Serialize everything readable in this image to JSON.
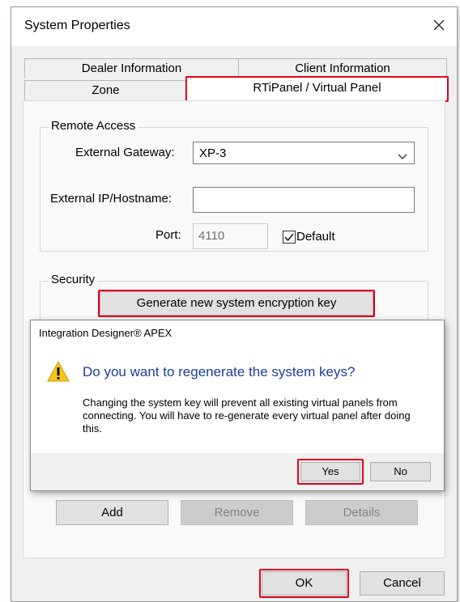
{
  "window": {
    "title": "System Properties"
  },
  "tabs": {
    "row1": [
      "Dealer Information",
      "Client Information"
    ],
    "row2": [
      "Zone",
      "RTiPanel / Virtual Panel"
    ]
  },
  "remote_access": {
    "group_label": "Remote Access",
    "gateway_label": "External Gateway:",
    "gateway_value": "XP-3",
    "ip_label": "External IP/Hostname:",
    "ip_value": "",
    "port_label": "Port:",
    "port_value": "4110",
    "default_label": "Default",
    "default_checked": true
  },
  "security": {
    "group_label": "Security",
    "generate_button": "Generate new system encryption key"
  },
  "panel_buttons": {
    "add": "Add",
    "remove": "Remove",
    "details": "Details"
  },
  "footer_buttons": {
    "ok": "OK",
    "cancel": "Cancel"
  },
  "dialog": {
    "title": "Integration Designer® APEX",
    "question": "Do you want to regenerate the system keys?",
    "message": "Changing the system key will prevent all existing virtual panels from connecting.  You will have to re-generate every virtual panel after doing this.",
    "yes": "Yes",
    "no": "No"
  },
  "colors": {
    "highlight": "#e0001b",
    "question": "#1a3e9c",
    "warning": "#f7c51b"
  }
}
